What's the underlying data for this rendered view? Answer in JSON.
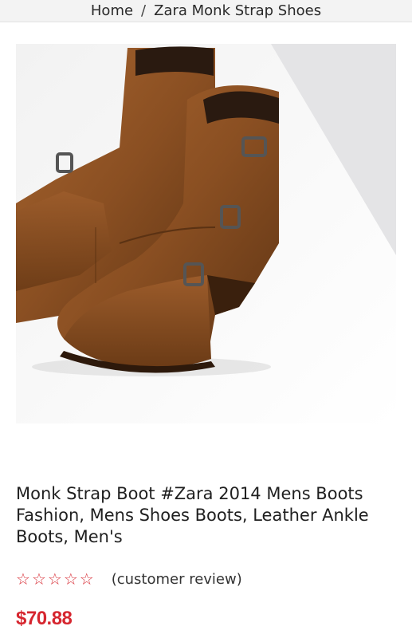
{
  "breadcrumb": {
    "home_label": "Home",
    "separator": "/",
    "current_label": "Zara Monk Strap Shoes"
  },
  "product": {
    "title": "Monk Strap Boot #Zara 2014 Mens Boots Fashion, Mens Shoes Boots, Leather Ankle Boots, Men's",
    "image_description_icon": "boot-photo",
    "rating": {
      "stars_filled": 0,
      "stars_total": 5,
      "star_glyph": "☆",
      "review_label": "(customer review)"
    },
    "price": "$70.88"
  },
  "colors": {
    "accent": "#d6262f",
    "star": "#d9343c",
    "leather": "#8a4f22"
  }
}
